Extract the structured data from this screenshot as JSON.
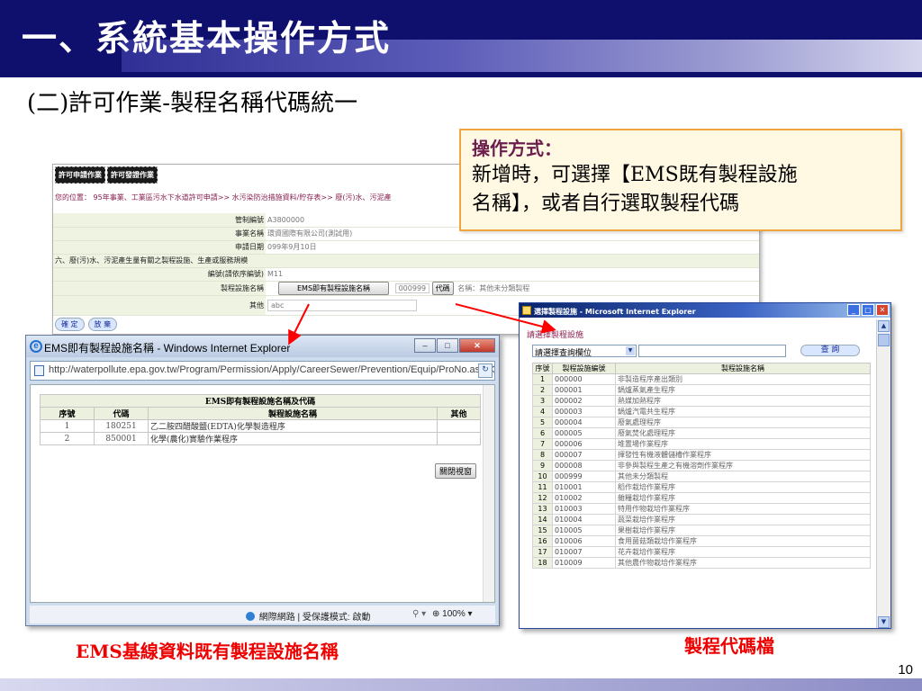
{
  "slide": {
    "title": "一、系統基本操作方式",
    "subtitle": "(二)許可作業-製程名稱代碼統一",
    "page_number": "10",
    "caption_left": "EMS基線資料既有製程設施名稱",
    "caption_right": "製程代碼檔",
    "colors": {
      "title_bg": "#0f0f6e",
      "callout_border": "#f2a53a",
      "caption_red": "#ee0000",
      "arrow_red": "#ff0000"
    }
  },
  "callout": {
    "title": "操作方式：",
    "line1": "新增時，可選擇【EMS既有製程設施",
    "line2": "名稱】，或者自行選取製程代碼"
  },
  "app": {
    "tabs": [
      "許可申請作業",
      "許可發證作業"
    ],
    "breadcrumb": "您的位置： 95年事業、工業區污水下水道許可申請>> 水污染防治措施資料/貯存表>> 廢(污)水、污泥產",
    "rows": [
      {
        "label": "管制編號",
        "value": "A3800000"
      },
      {
        "label": "事業名稱",
        "value": "環資國際有限公司(測試用)"
      },
      {
        "label": "申請日期",
        "value": "099年9月10日"
      }
    ],
    "section": "六、廢(污)水、污泥產生量有關之製程設施、生產或服務規模",
    "serial_label": "編號(請依序編號)",
    "serial_value": "M11",
    "facility_label": "製程設施名稱",
    "facility_button": "EMS即有製程設施名稱",
    "facility_code": "000999",
    "code_button": "代碼",
    "facility_name": "名稱：其他未分類製程",
    "other_label": "其他",
    "other_value": "abc",
    "confirm_button": "確 定",
    "back_button": "放 棄"
  },
  "window_left": {
    "title": "EMS即有製程設施名稱 - Windows Internet Explorer",
    "address": "http://waterpollute.epa.gov.tw/Program/Permission/Apply/CareerSewer/Prevention/Equip/ProNo.asp?ControlNO=",
    "table_caption": "EMS即有製程設施名稱及代碼",
    "headers": [
      "序號",
      "代碼",
      "製程設施名稱",
      "其他"
    ],
    "rows": [
      {
        "idx": "1",
        "code": "180251",
        "name": "乙二胺四醋酸鹽(EDTA)化學製造程序",
        "other": ""
      },
      {
        "idx": "2",
        "code": "850001",
        "name": "化學(農化)實驗作業程序",
        "other": ""
      }
    ],
    "close_button": "關閉視窗",
    "status_zone": "網際網路 | 受保護模式: 啟動",
    "zoom": "100%",
    "icons": [
      "ie-icon",
      "minimize-icon",
      "maximize-icon",
      "close-icon",
      "page-icon",
      "globe-icon"
    ]
  },
  "window_right": {
    "title": "選擇製程設施 - Microsoft Internet Explorer",
    "heading": "請選擇製程設施",
    "select_value": "請選擇查詢欄位",
    "query_button": "查 詢",
    "headers": [
      "序號",
      "製程設施編號",
      "製程設施名稱"
    ],
    "rows": [
      {
        "idx": "1",
        "code": "000000",
        "name": "非製造程序產出類別"
      },
      {
        "idx": "2",
        "code": "000001",
        "name": "鍋爐蒸氣產生程序"
      },
      {
        "idx": "3",
        "code": "000002",
        "name": "熱媒加熱程序"
      },
      {
        "idx": "4",
        "code": "000003",
        "name": "鍋爐汽電共生程序"
      },
      {
        "idx": "5",
        "code": "000004",
        "name": "廢氣處理程序"
      },
      {
        "idx": "6",
        "code": "000005",
        "name": "廢氣焚化處理程序"
      },
      {
        "idx": "7",
        "code": "000006",
        "name": "堆置場作業程序"
      },
      {
        "idx": "8",
        "code": "000007",
        "name": "揮發性有機液體儲槽作業程序"
      },
      {
        "idx": "9",
        "code": "000008",
        "name": "非參與製程生產之有機溶劑作業程序"
      },
      {
        "idx": "10",
        "code": "000999",
        "name": "其他未分類製程"
      },
      {
        "idx": "11",
        "code": "010001",
        "name": "稻作栽培作業程序"
      },
      {
        "idx": "12",
        "code": "010002",
        "name": "雜糧栽培作業程序"
      },
      {
        "idx": "13",
        "code": "010003",
        "name": "特用作物栽培作業程序"
      },
      {
        "idx": "14",
        "code": "010004",
        "name": "蔬菜栽培作業程序"
      },
      {
        "idx": "15",
        "code": "010005",
        "name": "果樹栽培作業程序"
      },
      {
        "idx": "16",
        "code": "010006",
        "name": "食用菌菇類栽培作業程序"
      },
      {
        "idx": "17",
        "code": "010007",
        "name": "花卉栽培作業程序"
      },
      {
        "idx": "18",
        "code": "010009",
        "name": "其他農作物栽培作業程序"
      }
    ]
  }
}
